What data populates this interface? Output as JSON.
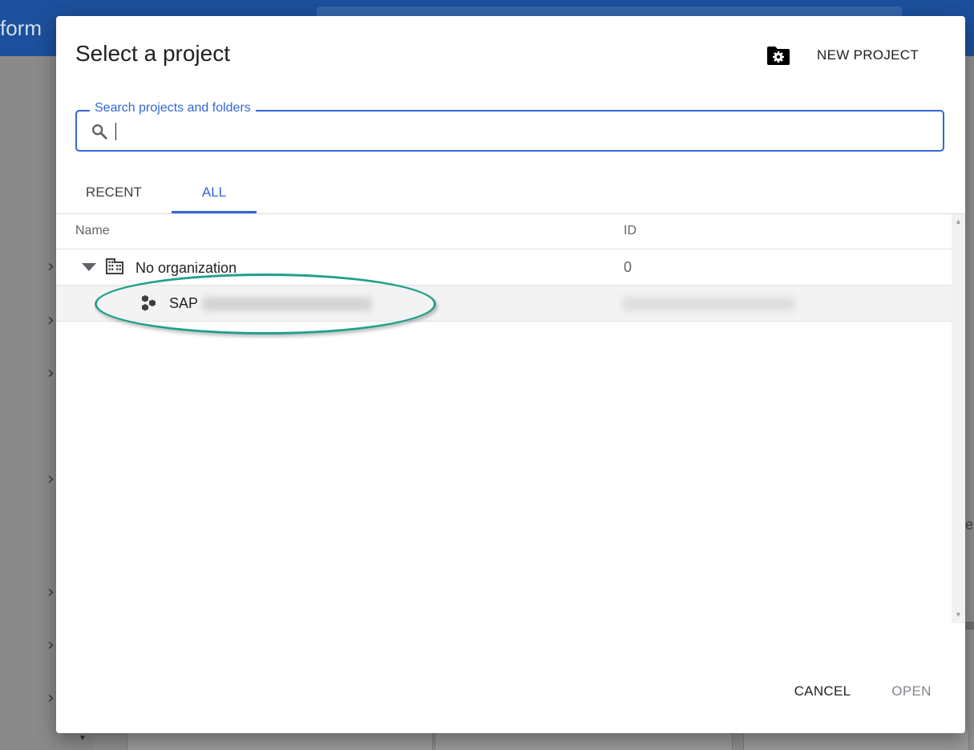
{
  "background": {
    "brand_text": "form",
    "right_edge_text": "e"
  },
  "dialog": {
    "title": "Select a project",
    "new_project_label": "NEW PROJECT",
    "search": {
      "label": "Search projects and folders",
      "value": "",
      "icon": "search-icon"
    },
    "tabs": [
      {
        "label": "RECENT",
        "active": false
      },
      {
        "label": "ALL",
        "active": true
      }
    ],
    "table": {
      "columns": [
        "Name",
        "ID"
      ],
      "rows": [
        {
          "type": "organization",
          "name": "No organization",
          "id": "0",
          "expanded": true,
          "icon": "organization-building-icon"
        },
        {
          "type": "project",
          "name": "SAP",
          "id": "",
          "icon": "project-hexagons-icon",
          "name_redacted": true,
          "id_redacted": true
        }
      ]
    },
    "footer": {
      "cancel_label": "CANCEL",
      "open_label": "OPEN",
      "open_enabled": false
    }
  },
  "colors": {
    "accent": "#3367d6",
    "highlight_annotation": "#21a08a",
    "top_bar": "#1c4f9c"
  }
}
